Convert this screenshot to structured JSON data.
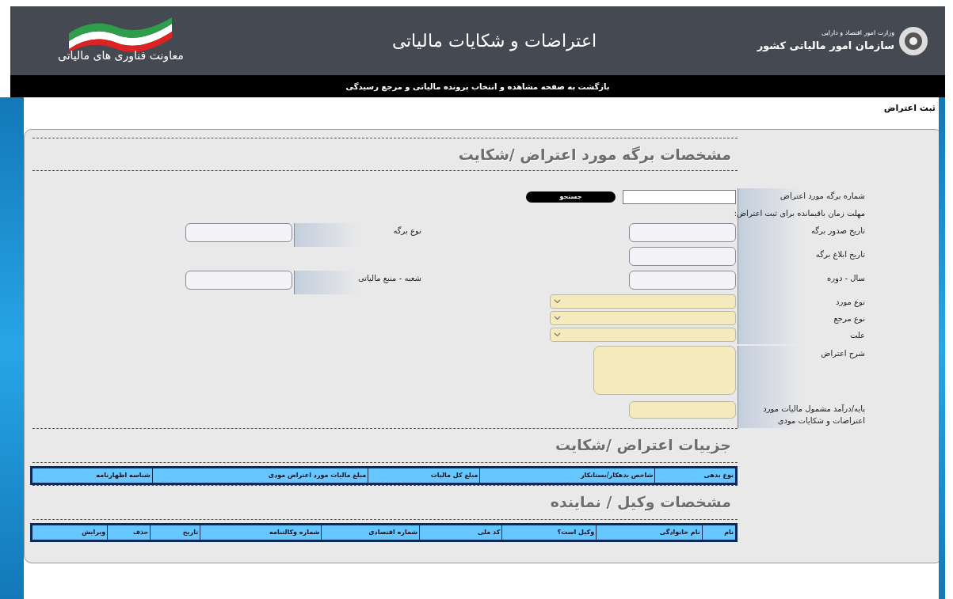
{
  "header": {
    "ministry": "وزارت امور اقتصاد و دارایی",
    "organization": "سازمان امور مالیاتی کشور",
    "title": "اعتراضات و شکایات مالیاتی",
    "department": "معاونت فناوری های مالیاتی"
  },
  "nav_link": "بازگشت به صفحه مشاهده و انتخاب پرونده مالیاتی و مرجع رسیدگی",
  "page_title": "ثبت اعتراض",
  "sections": [
    {
      "kind": "form",
      "title": "مشخصات برگه مورد اعتراض /شکایت",
      "rows": [
        [
          {
            "kind": "search",
            "label": "شماره برگه مورد اعتراض",
            "button": "جستجو"
          }
        ],
        [
          {
            "kind": "info",
            "label": "مهلت زمان باقیمانده برای ثبت اعتراض:"
          }
        ],
        [
          {
            "kind": "text",
            "label": "تاریخ صدور برگه"
          },
          {
            "kind": "text",
            "label": "نوع برگه"
          }
        ],
        [
          {
            "kind": "text",
            "label": "تاریخ ابلاغ برگه"
          }
        ],
        [
          {
            "kind": "text",
            "label": "سال - دوره"
          },
          {
            "kind": "text",
            "label": "شعبه - منبع مالیاتی"
          }
        ],
        [
          {
            "kind": "select",
            "label": "نوع مورد"
          }
        ],
        [
          {
            "kind": "select",
            "label": "نوع مرجع"
          }
        ],
        [
          {
            "kind": "select",
            "label": "علت"
          }
        ],
        [
          {
            "kind": "textarea",
            "label": "شرح اعتراض"
          }
        ],
        [
          {
            "kind": "amount",
            "label": "پایه/درآمد مشمول مالیات مورد اعتراضات و شکایات مودی"
          }
        ]
      ]
    },
    {
      "kind": "table",
      "title": "جزییات اعتراض /شکایت",
      "columns": [
        "نوع بدهی",
        "شاخص بدهکار/بستانکار",
        "مبلغ کل مالیات",
        "مبلغ مالیات مورد اعتراض مودی",
        "شناسه اظهارنامه"
      ]
    },
    {
      "kind": "table",
      "title": "مشخصات وکیل / نماینده",
      "columns": [
        "نام",
        "نام خانوادگی",
        "وکیل است؟",
        "کد ملی",
        "شماره اقتصادی",
        "شماره وکالتنامه",
        "تاریخ",
        "حذف",
        "ویرایش"
      ]
    }
  ]
}
